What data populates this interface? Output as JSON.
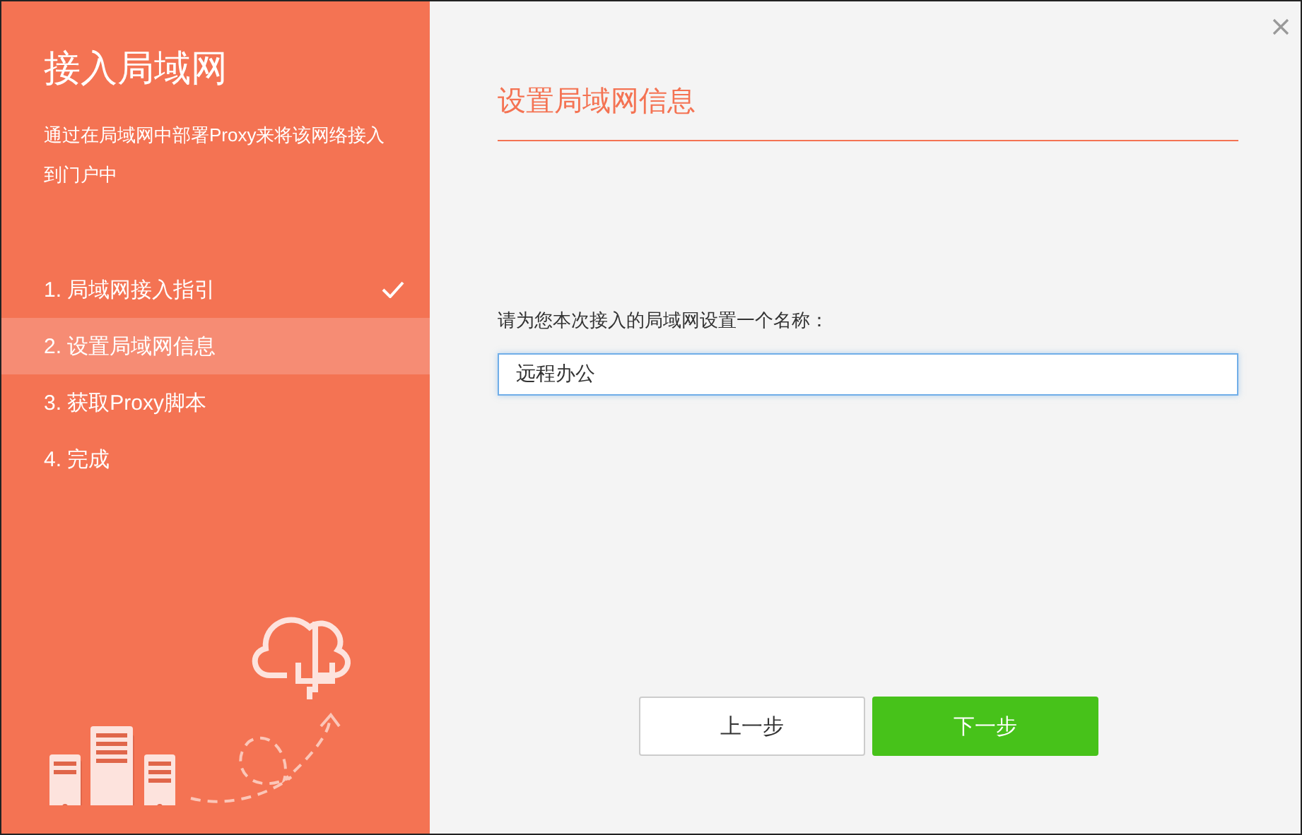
{
  "sidebar": {
    "title": "接入局域网",
    "description": "通过在局域网中部署Proxy来将该网络接入到门户中",
    "steps": [
      {
        "label": "1. 局域网接入指引",
        "completed": true,
        "selected": false
      },
      {
        "label": "2. 设置局域网信息",
        "completed": false,
        "selected": true
      },
      {
        "label": "3. 获取Proxy脚本",
        "completed": false,
        "selected": false
      },
      {
        "label": "4. 完成",
        "completed": false,
        "selected": false
      }
    ]
  },
  "main": {
    "heading": "设置局域网信息",
    "field_label": "请为您本次接入的局域网设置一个名称：",
    "name_field": {
      "value": "远程办公",
      "focused": true
    }
  },
  "buttons": [
    {
      "label": "上一步",
      "kind": "secondary"
    },
    {
      "label": "下一步",
      "kind": "primary"
    }
  ]
}
